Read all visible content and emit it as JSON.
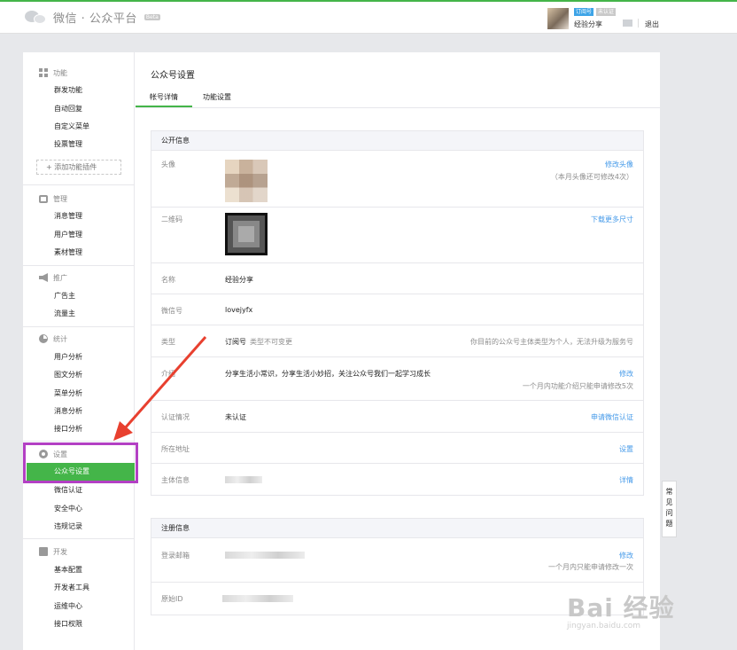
{
  "header": {
    "logo_text": "微信 · 公众平台",
    "beta_label": "Beta",
    "account_type_badge": "订阅号",
    "verify_badge": "未认证",
    "account_name": "经验分享",
    "logout_label": "退出"
  },
  "sidebar": {
    "groups": [
      {
        "title": "功能",
        "icon": "grid-icon",
        "items": [
          "群发功能",
          "自动回复",
          "自定义菜单",
          "投票管理"
        ]
      },
      {
        "title": "管理",
        "icon": "inbox-icon",
        "items": [
          "消息管理",
          "用户管理",
          "素材管理"
        ]
      },
      {
        "title": "推广",
        "icon": "speaker-icon",
        "items": [
          "广告主",
          "流量主"
        ]
      },
      {
        "title": "统计",
        "icon": "pie-chart-icon",
        "items": [
          "用户分析",
          "图文分析",
          "菜单分析",
          "消息分析",
          "接口分析"
        ]
      },
      {
        "title": "设置",
        "icon": "gear-icon",
        "items": [
          "公众号设置",
          "微信认证",
          "安全中心",
          "违规记录"
        ]
      },
      {
        "title": "开发",
        "icon": "code-icon",
        "items": [
          "基本配置",
          "开发者工具",
          "运维中心",
          "接口权限"
        ]
      }
    ],
    "add_plugin_label": "+ 添加功能插件",
    "active_item": "公众号设置"
  },
  "main": {
    "page_title": "公众号设置",
    "tabs": [
      {
        "label": "帐号详情",
        "active": true
      },
      {
        "label": "功能设置",
        "active": false
      }
    ],
    "public_info": {
      "title": "公开信息",
      "rows": {
        "avatar": {
          "label": "头像",
          "action": "修改头像",
          "note": "（本月头像还可修改4次）"
        },
        "qrcode": {
          "label": "二维码",
          "action": "下载更多尺寸"
        },
        "name": {
          "label": "名称",
          "value": "经验分享"
        },
        "wechat_id": {
          "label": "微信号",
          "value": "lovejyfx"
        },
        "type": {
          "label": "类型",
          "value": "订阅号",
          "hint": "类型不可变更",
          "note": "你目前的公众号主体类型为个人，无法升级为服务号"
        },
        "intro": {
          "label": "介绍",
          "value": "分享生活小常识，分享生活小妙招，关注公众号我们一起学习成长",
          "action": "修改",
          "note": "一个月内功能介绍只能申请修改5次"
        },
        "verify": {
          "label": "认证情况",
          "value": "未认证",
          "action": "申请微信认证"
        },
        "address": {
          "label": "所在地址",
          "action": "设置"
        },
        "subject": {
          "label": "主体信息",
          "action": "详情"
        }
      }
    },
    "register_info": {
      "title": "注册信息",
      "rows": {
        "email": {
          "label": "登录邮箱",
          "action": "修改",
          "note": "一个月内只能申请修改一次"
        },
        "origin_id": {
          "label": "原始ID"
        }
      }
    }
  },
  "help_tab_label": "常见问题",
  "watermark": {
    "main": "Bai 经验",
    "sub": "jingyan.baidu.com"
  },
  "colors": {
    "accent_green": "#44b549",
    "link_blue": "#459ae9",
    "highlight_purple": "#b340c4",
    "arrow_red": "#e8402f"
  }
}
